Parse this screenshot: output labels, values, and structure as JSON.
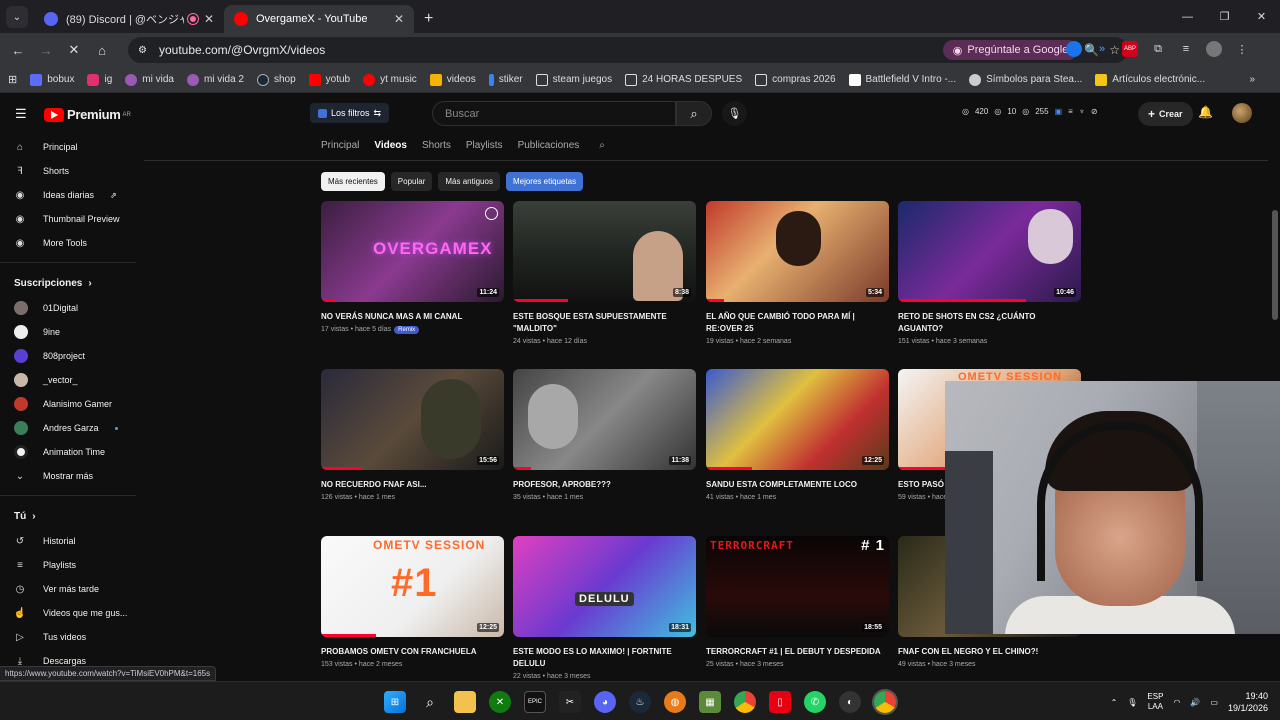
{
  "browser": {
    "tabs": [
      {
        "title": "(89) Discord | @ベンジャ",
        "close": "✕"
      },
      {
        "title": "OvergameX - YouTube",
        "close": "✕"
      }
    ],
    "new_tab": "+",
    "window_controls": [
      "—",
      "❐",
      "✕"
    ],
    "url": "youtube.com/@OvrgmX/videos",
    "ask_google": "Pregúntale a Google",
    "bookmarks": [
      "bobux",
      "ig",
      "mi vida",
      "mi vida 2",
      "shop",
      "yotub",
      "yt music",
      "videos",
      "stiker",
      "steam juegos",
      "24 HORAS DESPUES",
      "compras 2026",
      "Battlefield V Intro -...",
      "Símbolos para Stea...",
      "Artículos electrónic..."
    ],
    "more_bookmarks": "»",
    "status_url": "https://www.youtube.com/watch?v=TiMsiEV0hPM&t=165s"
  },
  "youtube": {
    "logo": "Premium",
    "logo_region": "AR",
    "filters_chip": "Los filtros",
    "search_placeholder": "Buscar",
    "stats": [
      "420",
      "10",
      "255"
    ],
    "create": "Crear",
    "sidebar": {
      "main": [
        "Principal",
        "Shorts",
        "Ideas diarias",
        "Thumbnail Preview",
        "More Tools"
      ],
      "subscriptions_header": "Suscripciones",
      "subscriptions": [
        "01Digital",
        "9ine",
        "808project",
        "_vector_",
        "Alanisimo Gamer",
        "Andres Garza",
        "Animation Time"
      ],
      "show_more": "Mostrar más",
      "you_header": "Tú",
      "you": [
        "Historial",
        "Playlists",
        "Ver más tarde",
        "Videos que me gus...",
        "Tus videos",
        "Descargas"
      ]
    },
    "channel_tabs": [
      "Principal",
      "Videos",
      "Shorts",
      "Playlists",
      "Publicaciones"
    ],
    "chips": [
      "Más recientes",
      "Popular",
      "Más antiguos",
      "Mejores etiquetas"
    ],
    "videos": [
      {
        "title": "NO VERÁS NUNCA MAS A MI CANAL",
        "meta": "17 vistas • hace 5 días",
        "badge": "Remix",
        "duration": "11:24",
        "overlay": "OVERGAMEX",
        "progress": 0.08
      },
      {
        "title": "ESTE BOSQUE ESTA SUPUESTAMENTE \"MALDITO\"",
        "meta": "24 vistas • hace 12 días",
        "duration": "8:38",
        "progress": 0.3
      },
      {
        "title": "EL AÑO QUE CAMBIÓ TODO PARA MÍ | RE:OVER 25",
        "meta": "19 vistas • hace 2 semanas",
        "duration": "5:34",
        "progress": 0.1
      },
      {
        "title": "RETO DE SHOTS EN CS2 ¿CUÁNTO AGUANTO?",
        "meta": "151 vistas • hace 3 semanas",
        "duration": "10:46",
        "progress": 0.7
      },
      {
        "title": "NO RECUERDO FNAF ASI...",
        "meta": "126 vistas • hace 1 mes",
        "duration": "15:56",
        "progress": 0.22
      },
      {
        "title": "PROFESOR, APROBE???",
        "meta": "35 vistas • hace 1 mes",
        "duration": "11:38",
        "progress": 0.1
      },
      {
        "title": "SANDU ESTA COMPLETAMENTE LOCO",
        "meta": "41 vistas • hace 1 mes",
        "duration": "12:25",
        "progress": 0.25
      },
      {
        "title": "ESTO PASÓ OME TV",
        "meta": "59 vistas • hace",
        "duration": "",
        "overlay": "OMETV SESSION",
        "progress": 0.4
      },
      {
        "title": "PROBAMOS OMETV CON FRANCHUELA",
        "meta": "153 vistas • hace 2 meses",
        "duration": "12:25",
        "overlay": "OMETV SESSION",
        "overlay2": "#1",
        "progress": 0.3
      },
      {
        "title": "ESTE MODO ES LO MAXIMO! | FORTNITE DELULU",
        "meta": "22 vistas • hace 3 meses",
        "duration": "18:31",
        "overlay": "DELULU",
        "progress": 0.0
      },
      {
        "title": "TERRORCRAFT #1 | EL DEBUT Y DESPEDIDA",
        "meta": "25 vistas • hace 3 meses",
        "duration": "18:55",
        "overlay": "TERRORCRAFT",
        "overlay2": "# 1",
        "progress": 0.0
      },
      {
        "title": "FNAF CON EL NEGRO Y EL CHINO?!",
        "meta": "49 vistas • hace 3 meses",
        "duration": "",
        "progress": 0.0
      }
    ]
  },
  "taskbar": {
    "lang": "ESP",
    "lang2": "LAA",
    "time": "19:40",
    "date": "19/1/2026"
  }
}
